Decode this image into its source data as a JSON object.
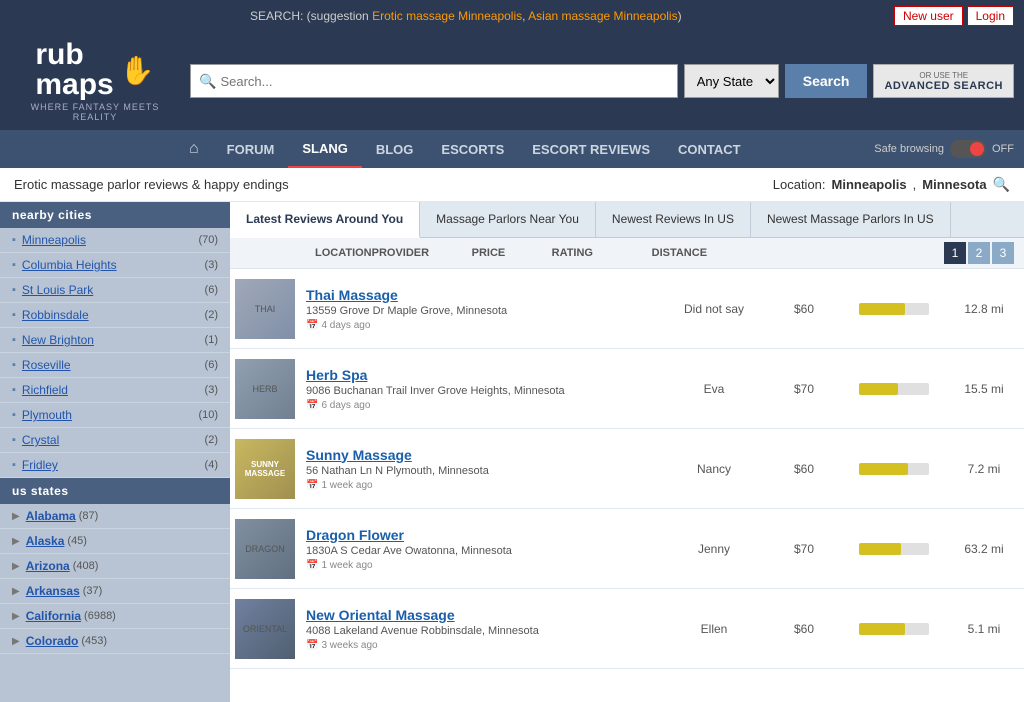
{
  "site": {
    "logo_rub": "rub",
    "logo_maps": "maps",
    "logo_tagline": "WHERE FANTASY MEETS REALITY",
    "hand_icon": "✋"
  },
  "topbar": {
    "search_suggestion_prefix": "SEARCH: (suggestion",
    "suggestion_link1": "Erotic massage Minneapolis",
    "suggestion_link2": "Asian massage Minneapolis",
    "new_user_label": "New user",
    "login_label": "Login"
  },
  "search": {
    "placeholder": "Search...",
    "state_default": "Any State",
    "state_arrow": "▼",
    "search_button": "Search",
    "advanced_label1": "OR USE THE",
    "advanced_label2": "ADVANCED SEARCH"
  },
  "nav": {
    "home_icon": "⌂",
    "items": [
      {
        "label": "FORUM",
        "active": false
      },
      {
        "label": "SLANG",
        "active": true,
        "slang": true
      },
      {
        "label": "BLOG",
        "active": false
      },
      {
        "label": "ESCORTS",
        "active": false
      },
      {
        "label": "ESCORT REVIEWS",
        "active": false
      },
      {
        "label": "CONTACT",
        "active": false
      }
    ],
    "safe_browse_label": "Safe browsing",
    "toggle_label": "OFF"
  },
  "subtitle": {
    "text": "Erotic massage parlor reviews & happy endings",
    "location_label": "Location:",
    "location_city": "Minneapolis",
    "location_state": "Minnesota"
  },
  "tabs": [
    {
      "label": "Latest Reviews Around You",
      "active": true
    },
    {
      "label": "Massage Parlors Near You",
      "active": false
    },
    {
      "label": "Newest Reviews In US",
      "active": false
    },
    {
      "label": "Newest Massage Parlors In US",
      "active": false
    }
  ],
  "pagination": [
    "1",
    "2",
    "3"
  ],
  "col_headers": {
    "location": "LOCATION",
    "provider": "PROVIDER",
    "price": "PRICE",
    "rating": "RATING",
    "distance": "DISTANCE"
  },
  "listings": [
    {
      "name": "Thai Massage",
      "address": "13559 Grove Dr Maple Grove, Minnesota",
      "date": "4 days ago",
      "provider": "Did not say",
      "price": "$60",
      "rating_pct": 65,
      "distance": "12.8 mi",
      "thumb_class": "listing-thumb-thai",
      "thumb_text": "THAI"
    },
    {
      "name": "Herb Spa",
      "address": "9086 Buchanan Trail Inver Grove Heights, Minnesota",
      "date": "6 days ago",
      "provider": "Eva",
      "price": "$70",
      "rating_pct": 55,
      "distance": "15.5 mi",
      "thumb_class": "listing-thumb-herb",
      "thumb_text": "HERB"
    },
    {
      "name": "Sunny Massage",
      "address": "56 Nathan Ln N Plymouth, Minnesota",
      "date": "1 week ago",
      "provider": "Nancy",
      "price": "$60",
      "rating_pct": 70,
      "distance": "7.2 mi",
      "thumb_class": "listing-thumb-sunny",
      "thumb_text": "SUNNY MASSAGE"
    },
    {
      "name": "Dragon Flower",
      "address": "1830A S Cedar Ave Owatonna, Minnesota",
      "date": "1 week ago",
      "provider": "Jenny",
      "price": "$70",
      "rating_pct": 60,
      "distance": "63.2 mi",
      "thumb_class": "listing-thumb-dragon",
      "thumb_text": "DRAGON"
    },
    {
      "name": "New Oriental Massage",
      "address": "4088 Lakeland Avenue Robbinsdale, Minnesota",
      "date": "3 weeks ago",
      "provider": "Ellen",
      "price": "$60",
      "rating_pct": 65,
      "distance": "5.1 mi",
      "thumb_class": "listing-thumb-oriental",
      "thumb_text": "ORIENTAL"
    }
  ],
  "sidebar": {
    "nearby_cities_header": "nearby cities",
    "cities": [
      {
        "name": "Minneapolis",
        "count": "(70)"
      },
      {
        "name": "Columbia Heights",
        "count": "(3)"
      },
      {
        "name": "St Louis Park",
        "count": "(6)"
      },
      {
        "name": "Robbinsdale",
        "count": "(2)"
      },
      {
        "name": "New Brighton",
        "count": "(1)"
      },
      {
        "name": "Roseville",
        "count": "(6)"
      },
      {
        "name": "Richfield",
        "count": "(3)"
      },
      {
        "name": "Plymouth",
        "count": "(10)"
      },
      {
        "name": "Crystal",
        "count": "(2)"
      },
      {
        "name": "Fridley",
        "count": "(4)"
      }
    ],
    "us_states_header": "us states",
    "states": [
      {
        "name": "Alabama",
        "count": "(87)"
      },
      {
        "name": "Alaska",
        "count": "(45)"
      },
      {
        "name": "Arizona",
        "count": "(408)"
      },
      {
        "name": "Arkansas",
        "count": "(37)"
      },
      {
        "name": "California",
        "count": "(6988)"
      },
      {
        "name": "Colorado",
        "count": "(453)"
      }
    ]
  }
}
